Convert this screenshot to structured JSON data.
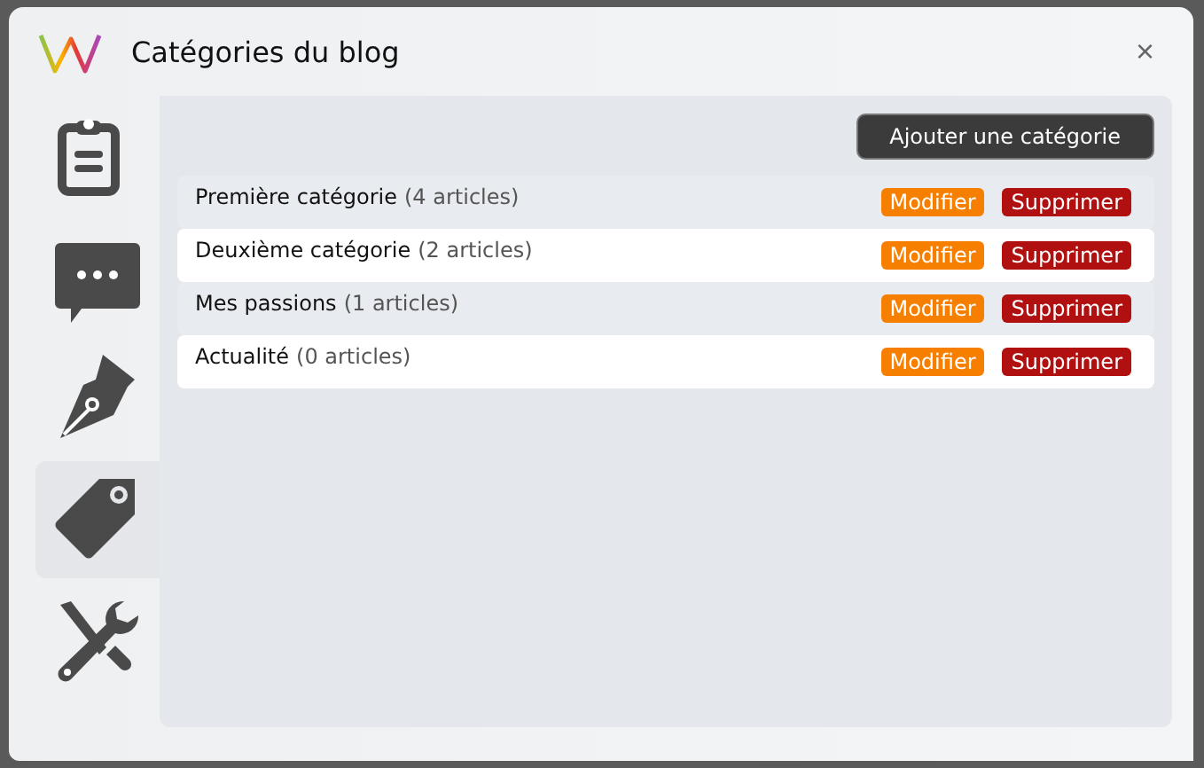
{
  "window": {
    "title": "Catégories du blog",
    "close": "×"
  },
  "nav": [
    {
      "selected": false
    },
    {
      "selected": false
    },
    {
      "selected": false
    },
    {
      "selected": true
    },
    {
      "selected": false
    }
  ],
  "add_button": "Ajouter une catégorie",
  "categories": [
    {
      "name": "Première catégorie",
      "count": "(4 articles)",
      "edit": "Modifier",
      "delete": "Supprimer"
    },
    {
      "name": "Deuxième catégorie",
      "count": "(2 articles)",
      "edit": "Modifier",
      "delete": "Supprimer"
    },
    {
      "name": "Mes passions",
      "count": "(1 articles)",
      "edit": "Modifier",
      "delete": "Supprimer"
    },
    {
      "name": "Actualité",
      "count": "(0 articles)",
      "edit": "Modifier",
      "delete": "Supprimer"
    }
  ]
}
